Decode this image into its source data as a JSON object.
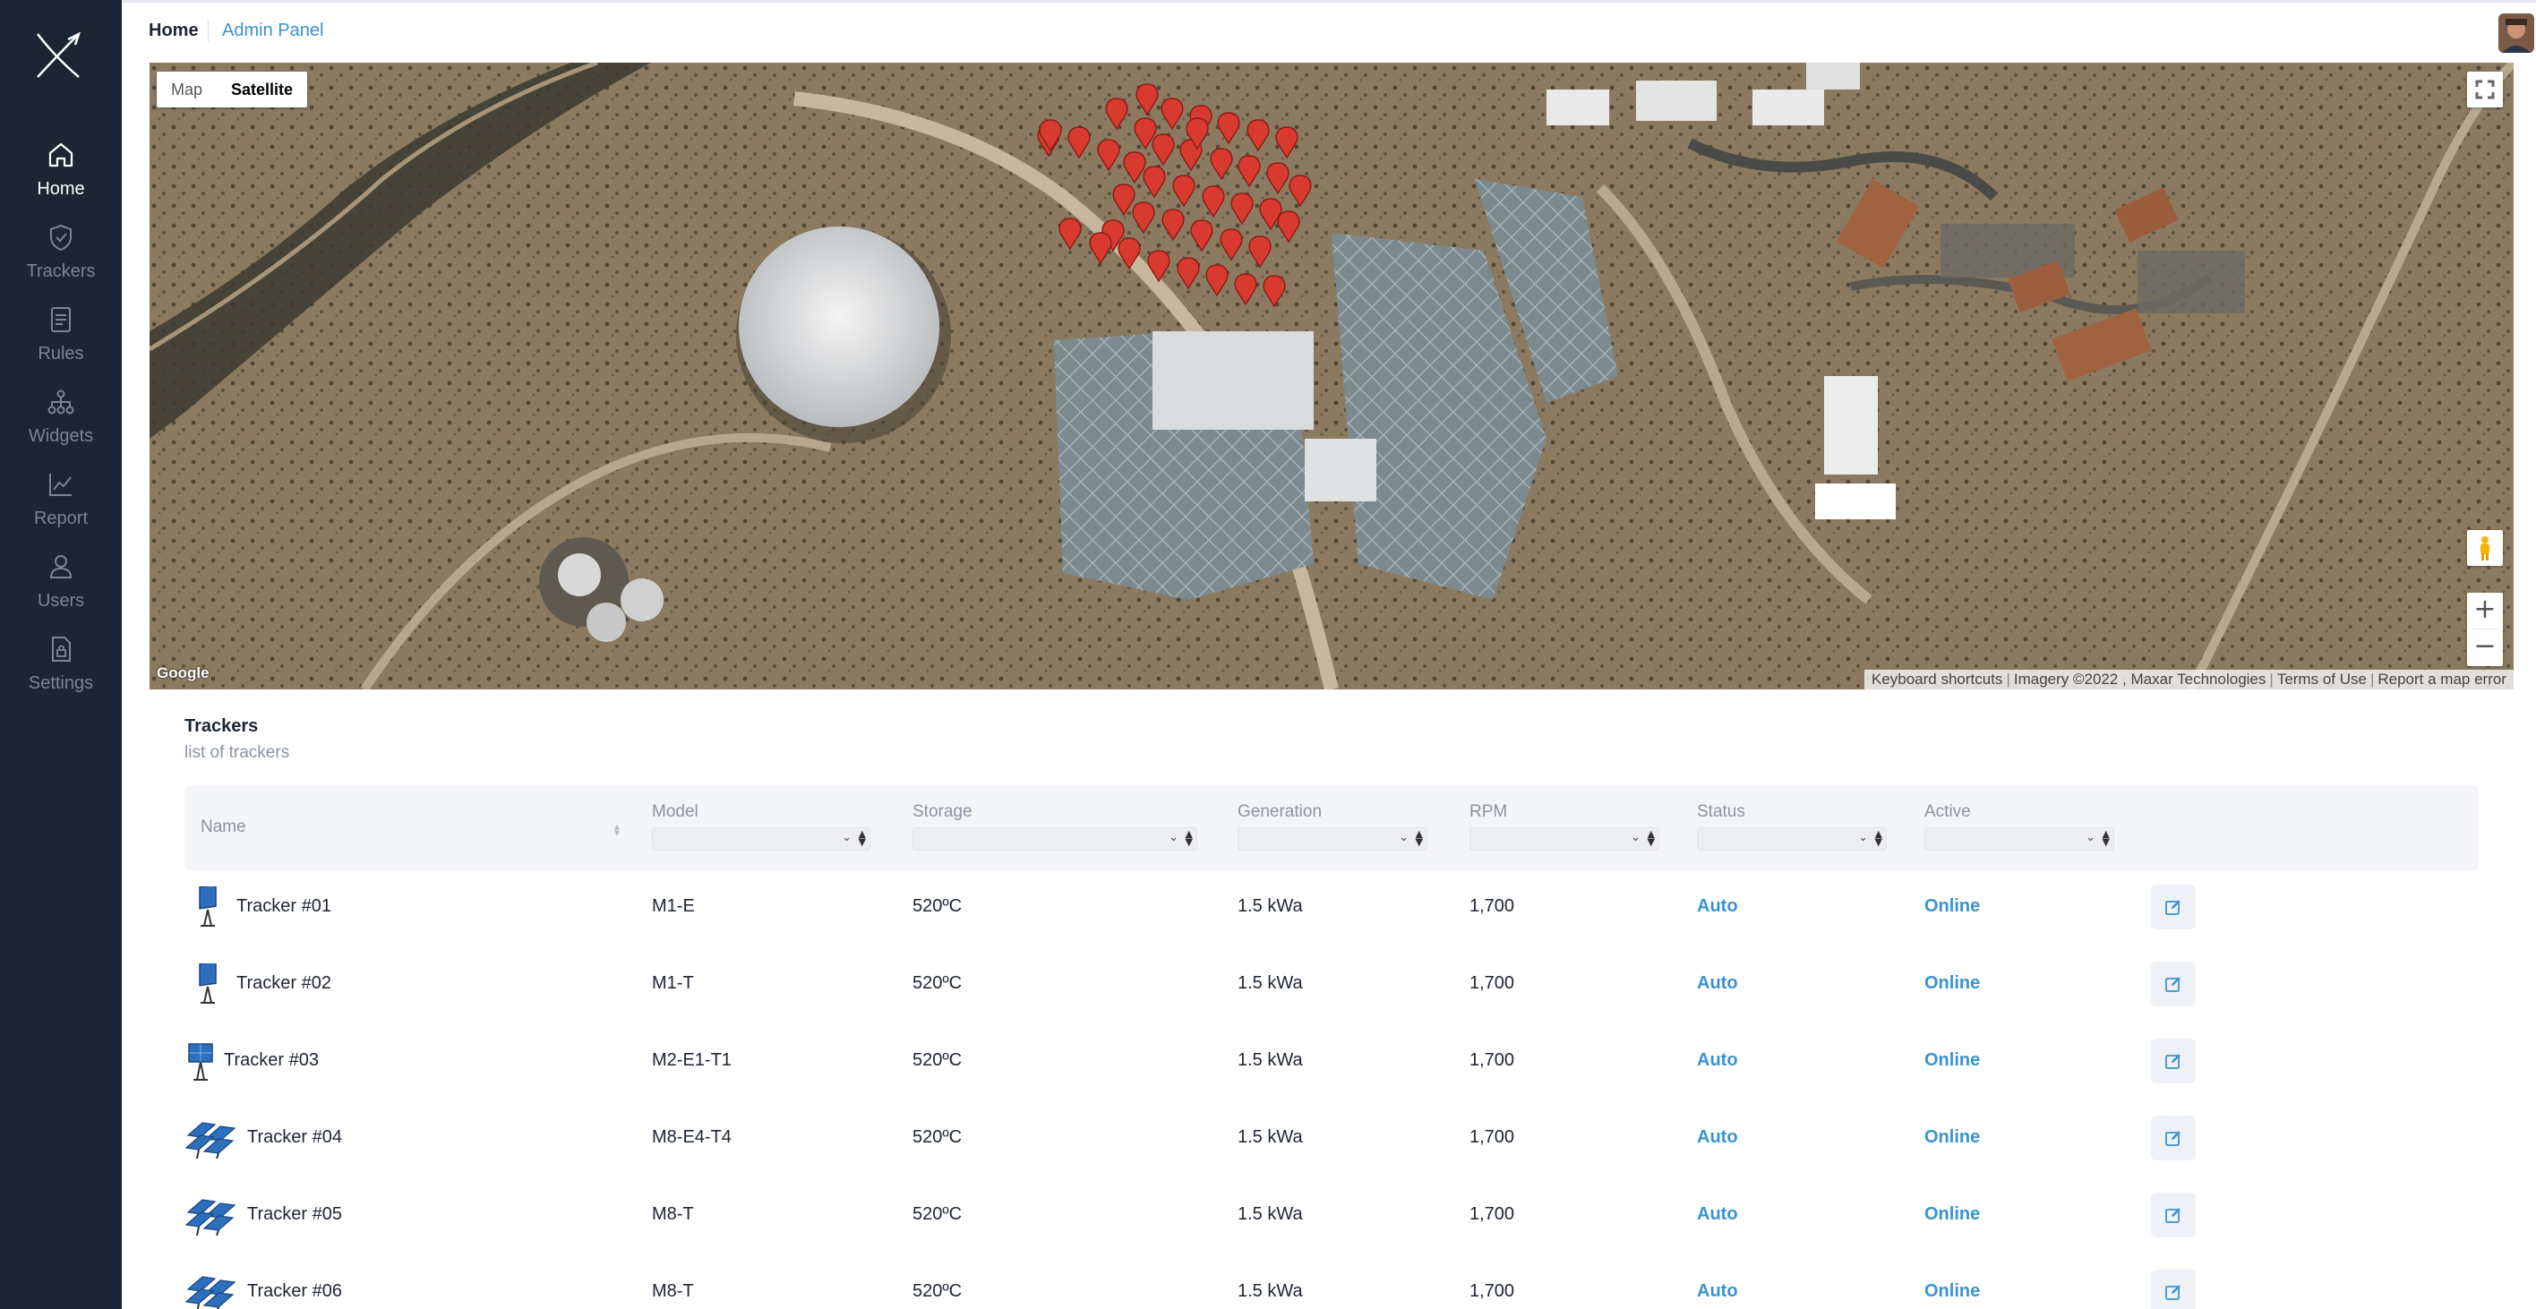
{
  "nav": {
    "items": [
      {
        "label": "Home",
        "icon": "home-icon",
        "active": true
      },
      {
        "label": "Trackers",
        "icon": "shield-icon",
        "active": false
      },
      {
        "label": "Rules",
        "icon": "document-icon",
        "active": false
      },
      {
        "label": "Widgets",
        "icon": "network-icon",
        "active": false
      },
      {
        "label": "Report",
        "icon": "chart-icon",
        "active": false
      },
      {
        "label": "Users",
        "icon": "user-icon",
        "active": false
      },
      {
        "label": "Settings",
        "icon": "file-lock-icon",
        "active": false
      }
    ]
  },
  "breadcrumb": {
    "home": "Home",
    "admin": "Admin Panel"
  },
  "map": {
    "type_map": "Map",
    "type_satellite": "Satellite",
    "selected_type": "Satellite",
    "google": "Google",
    "attribution": {
      "shortcuts": "Keyboard shortcuts",
      "imagery": "Imagery ©2022 , Maxar Technologies",
      "terms": "Terms of Use",
      "report": "Report a map error"
    },
    "zoom_in": "+",
    "zoom_out": "−"
  },
  "trackers": {
    "title": "Trackers",
    "subtitle": "list of trackers",
    "columns": {
      "name": "Name",
      "model": "Model",
      "storage": "Storage",
      "generation": "Generation",
      "rpm": "RPM",
      "status": "Status",
      "active": "Active"
    },
    "rows": [
      {
        "name": "Tracker #01",
        "model": "M1-E",
        "storage": "520ºC",
        "generation": "1.5 kWa",
        "rpm": "1,700",
        "status": "Auto",
        "active": "Online",
        "icon": "single-panel-icon"
      },
      {
        "name": "Tracker #02",
        "model": "M1-T",
        "storage": "520ºC",
        "generation": "1.5 kWa",
        "rpm": "1,700",
        "status": "Auto",
        "active": "Online",
        "icon": "single-panel-icon"
      },
      {
        "name": "Tracker #03",
        "model": "M2-E1-T1",
        "storage": "520ºC",
        "generation": "1.5 kWa",
        "rpm": "1,700",
        "status": "Auto",
        "active": "Online",
        "icon": "double-panel-icon"
      },
      {
        "name": "Tracker #04",
        "model": "M8-E4-T4",
        "storage": "520ºC",
        "generation": "1.5 kWa",
        "rpm": "1,700",
        "status": "Auto",
        "active": "Online",
        "icon": "panel-array-icon"
      },
      {
        "name": "Tracker #05",
        "model": "M8-T",
        "storage": "520ºC",
        "generation": "1.5 kWa",
        "rpm": "1,700",
        "status": "Auto",
        "active": "Online",
        "icon": "panel-array-icon"
      },
      {
        "name": "Tracker #06",
        "model": "M8-T",
        "storage": "520ºC",
        "generation": "1.5 kWa",
        "rpm": "1,700",
        "status": "Auto",
        "active": "Online",
        "icon": "panel-array-icon"
      }
    ]
  },
  "colors": {
    "sidebar": "#1d2433",
    "accent": "#3a93d0",
    "marker": "#d93a2f"
  }
}
